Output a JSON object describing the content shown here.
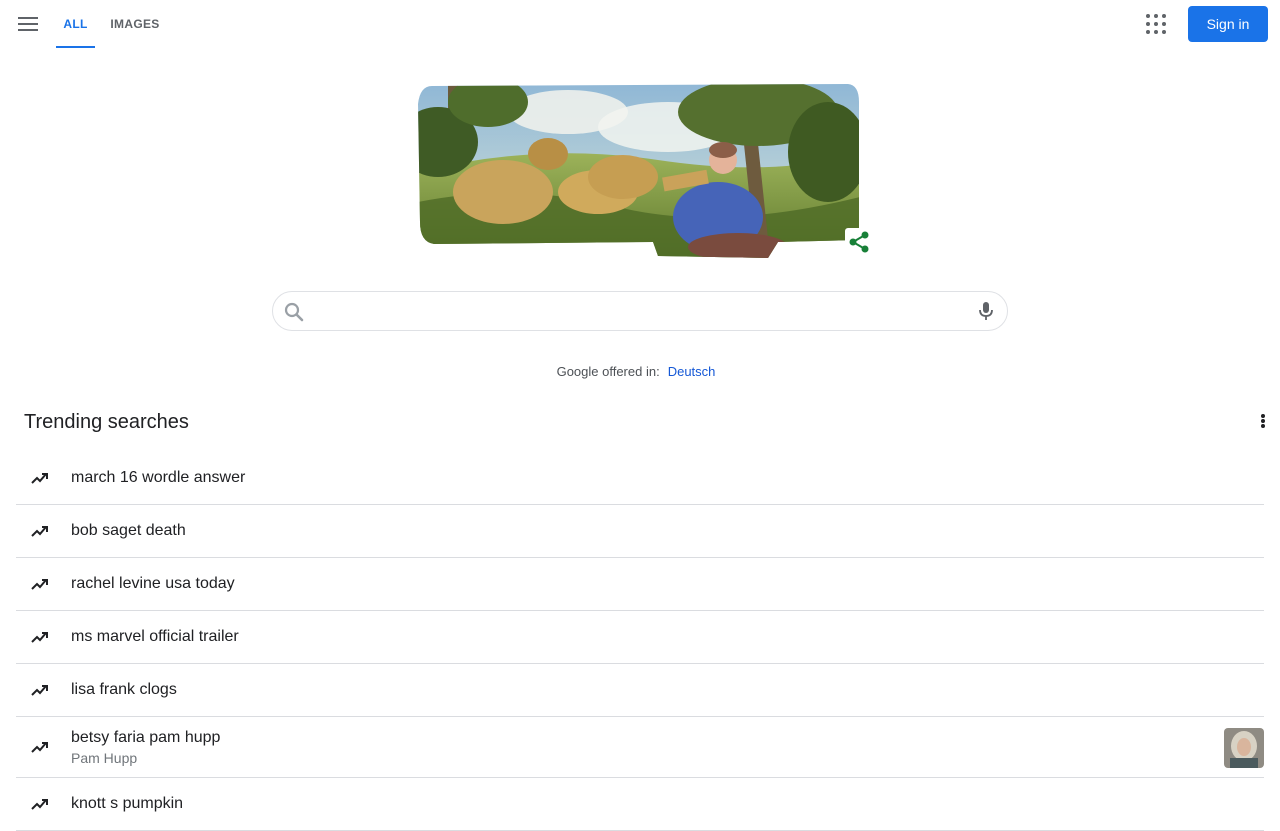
{
  "header": {
    "tabs": [
      {
        "label": "ALL",
        "active": true
      },
      {
        "label": "IMAGES",
        "active": false
      }
    ],
    "apps_icon": "apps-grid-icon",
    "signin_label": "Sign in",
    "accent_color": "#1a73e8"
  },
  "doodle": {
    "icon": "doodle-illustration",
    "share_icon": "share-icon",
    "share_color": "#188038"
  },
  "search": {
    "value": "",
    "placeholder": "",
    "search_icon": "search-icon",
    "mic_icon": "microphone-icon"
  },
  "language": {
    "prefix": "Google offered in:",
    "link": "Deutsch"
  },
  "trending": {
    "title": "Trending searches",
    "items": [
      {
        "text": "march 16 wordle answer",
        "sub": ""
      },
      {
        "text": "bob saget death",
        "sub": ""
      },
      {
        "text": "rachel levine usa today",
        "sub": ""
      },
      {
        "text": "ms marvel official trailer",
        "sub": ""
      },
      {
        "text": "lisa frank clogs",
        "sub": ""
      },
      {
        "text": "betsy faria pam hupp",
        "sub": "Pam Hupp"
      },
      {
        "text": "knott s pumpkin",
        "sub": ""
      }
    ]
  }
}
